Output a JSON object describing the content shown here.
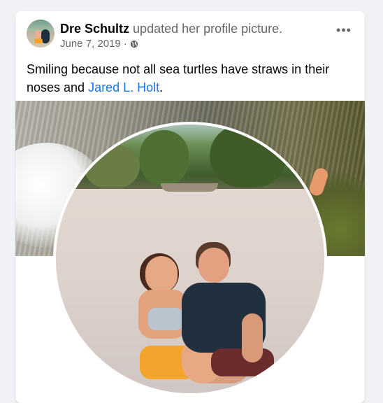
{
  "post": {
    "author": "Dre Schultz",
    "action": "updated her profile picture.",
    "date": "June 7, 2019",
    "date_separator": "·",
    "privacy_icon": "globe-icon",
    "more_icon": "more-options-icon",
    "more_label": "•••",
    "text_before_tag": "Smiling because not all sea turtles have straws in their noses and ",
    "tagged_person": "Jared L. Holt",
    "text_after_tag": "."
  },
  "colors": {
    "link": "#1876f2",
    "secondary_text": "#65676b",
    "primary_text": "#050505",
    "page_background": "#f0f2f5"
  }
}
